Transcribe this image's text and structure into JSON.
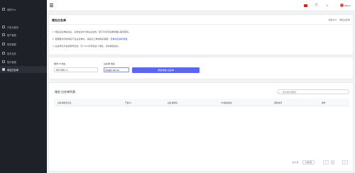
{
  "sidebar": {
    "items": [
      {
        "label": "我的Pod",
        "active": false,
        "has_chevron": false
      },
      {
        "label": "产品与服务",
        "active": false,
        "has_chevron": true
      },
      {
        "label": "账户管理",
        "active": false,
        "has_chevron": true
      },
      {
        "label": "财务管理",
        "active": false,
        "has_chevron": true
      },
      {
        "label": "技术支持",
        "active": false,
        "has_chevron": true
      },
      {
        "label": "拓扑管理",
        "active": false,
        "has_chevron": false
      },
      {
        "label": "域名白名单",
        "active": true,
        "has_chevron": false
      }
    ]
  },
  "topbar": {
    "menu_icon": "hamburger-icon",
    "cart_icon": "cart-icon",
    "bell_icon": "bell-icon",
    "user_name": "Marvin"
  },
  "intro": {
    "title": "域名白名单",
    "breadcrumb": [
      "我的Pod",
      "域名白名单"
    ],
    "notes": [
      {
        "text": "1. 域名白名单提交后，系统会在5分钟左右生效，若不可访问请重新确认各项填写。",
        "link": ""
      },
      {
        "text": "2. 若需要访问的域名不在白名单中，请提交工单或联系客服，",
        "link": "查看域名解析教程"
      },
      {
        "text": "3. 白名单仅对当前账号生效，同一Pod可添加多个域名，请勿重复提交。",
        "link": ""
      }
    ]
  },
  "form": {
    "ip_label": "服务 IP 地址",
    "ip_value": "192.168.1.1",
    "domain_label": "白名单 域名",
    "domain_value": "qingse.vdu.cn",
    "submit_label": "添加/修改 白名单"
  },
  "list": {
    "title": "域名 白名单列表",
    "search_placeholder": "搜索域名或服务",
    "columns": [
      "白名单域名信息",
      "产品 IP",
      "白名单域名",
      "ICP备案状态",
      "添加时间",
      "操作"
    ],
    "rows": []
  },
  "pagination": {
    "total_text": "共 0 条",
    "page_size": "10条/页",
    "prev": "<",
    "page": "1",
    "next": ">"
  },
  "colors": {
    "sidebar_bg": "#1f2128",
    "primary": "#5a67f2",
    "link": "#3b5bdb",
    "flag": "#d8241c"
  }
}
